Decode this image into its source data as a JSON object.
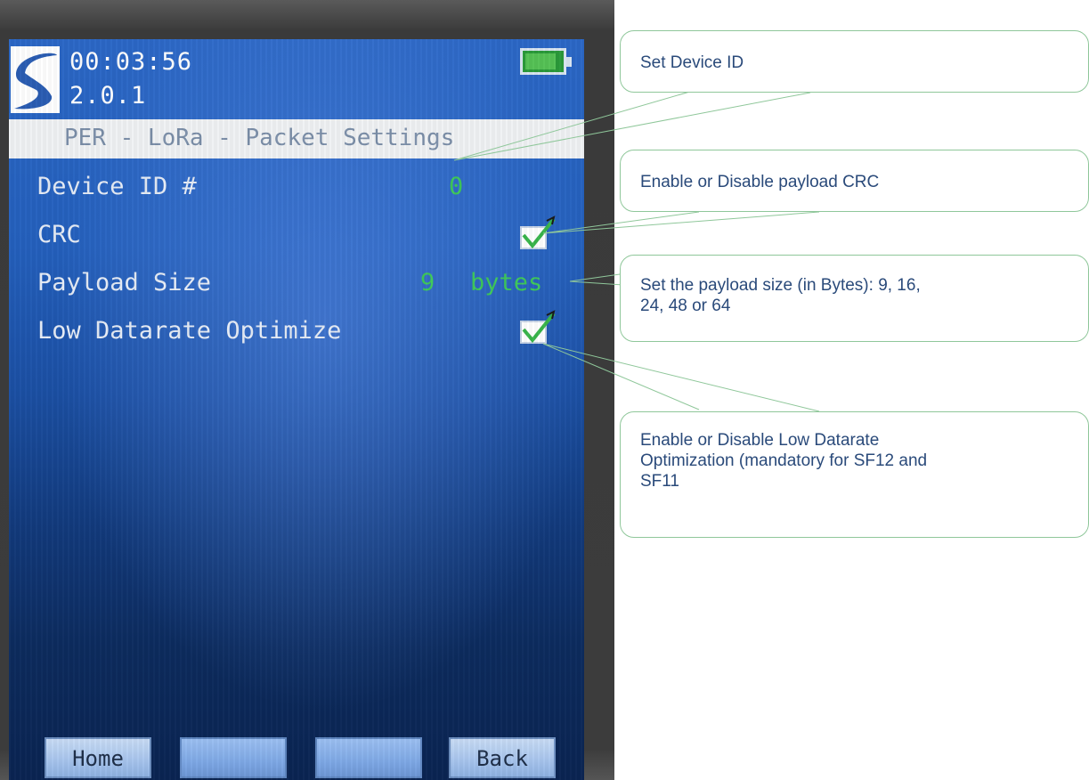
{
  "device": {
    "clock": "00:03:56",
    "version": "2.0.1",
    "screen_title": "PER - LoRa - Packet Settings",
    "battery_level": 0.85
  },
  "settings": [
    {
      "label": "Device ID #",
      "value": "0"
    },
    {
      "label": "CRC",
      "checked": true
    },
    {
      "label": "Payload Size",
      "value": "9",
      "unit": "bytes"
    },
    {
      "label": "Low Datarate Optimize",
      "checked": true
    }
  ],
  "softkeys": [
    "Home",
    "",
    "",
    "Back"
  ],
  "callouts": {
    "device_id": "Set Device ID",
    "crc": "Enable or Disable payload CRC",
    "payload_line1": "Set the payload size (in Bytes): 9, 16,",
    "payload_line2": "24, 48 or 64",
    "ldro_line1": "Enable or Disable Low Datarate",
    "ldro_line2": "Optimization (mandatory for SF12 and",
    "ldro_line3": "SF11"
  },
  "colors": {
    "value_green": "#3ec85a",
    "callout_border": "#8fc79a",
    "callout_text": "#2a4a7a"
  }
}
